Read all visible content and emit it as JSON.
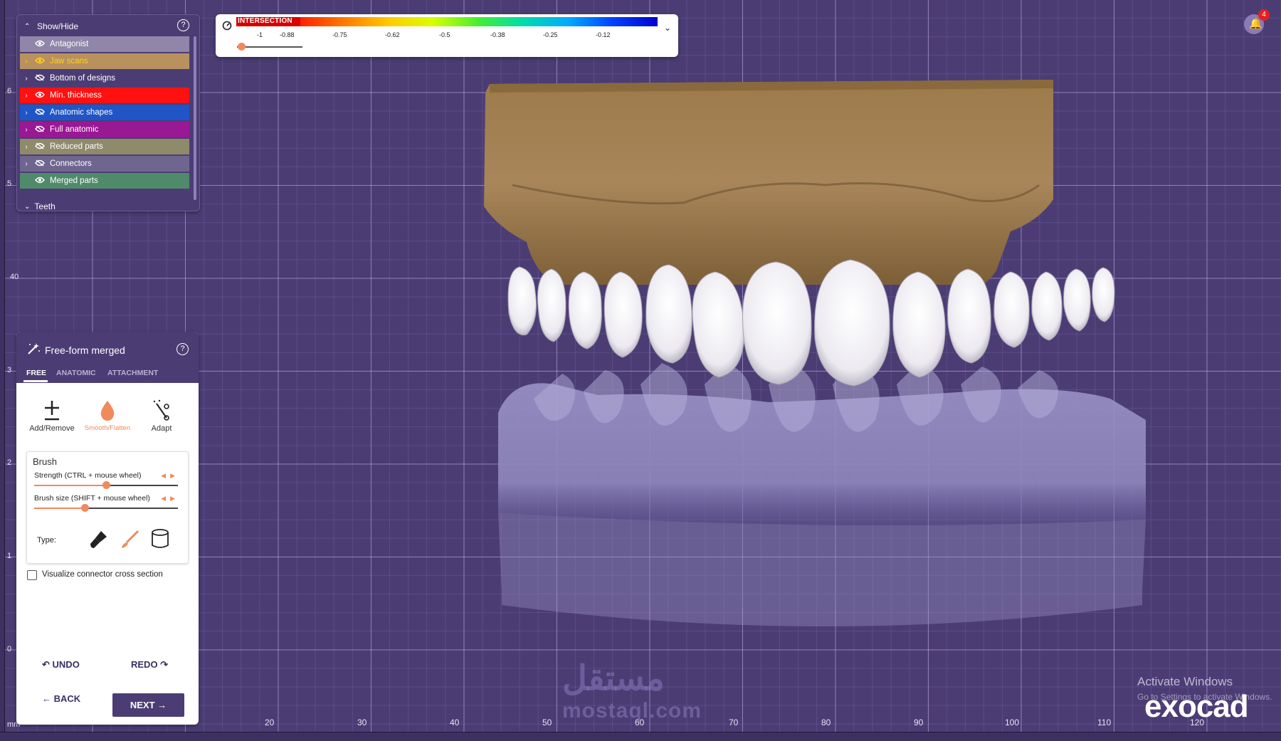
{
  "show_hide": {
    "title": "Show/Hide",
    "help_icon": "?",
    "layers": [
      {
        "label": "Antagonist",
        "expandable": false,
        "visible": true,
        "color": "#8f86a9",
        "text_color": "#ffffff"
      },
      {
        "label": "Jaw scans",
        "expandable": true,
        "visible": true,
        "color": "#b8915e",
        "text_color": "#ffd21a"
      },
      {
        "label": "Bottom of designs",
        "expandable": true,
        "visible": false,
        "color": "#4b3d74",
        "text_color": "#ffffff"
      },
      {
        "label": "Min. thickness",
        "expandable": true,
        "visible": true,
        "color": "#ff1111",
        "text_color": "#ffffff"
      },
      {
        "label": "Anatomic shapes",
        "expandable": true,
        "visible": false,
        "color": "#1f55c6",
        "text_color": "#ffffff"
      },
      {
        "label": "Full anatomic",
        "expandable": true,
        "visible": false,
        "color": "#991894",
        "text_color": "#ffffff"
      },
      {
        "label": "Reduced parts",
        "expandable": true,
        "visible": false,
        "color": "#8f8a6a",
        "text_color": "#ffffff"
      },
      {
        "label": "Connectors",
        "expandable": true,
        "visible": false,
        "color": "#6f6690",
        "text_color": "#ffffff"
      },
      {
        "label": "Merged parts",
        "expandable": false,
        "visible": true,
        "color": "#4f8a6a",
        "text_color": "#ffffff"
      }
    ],
    "teeth_label": "Teeth"
  },
  "colorbar": {
    "label": "INTERSECTION",
    "ticks": [
      "-1",
      "-0.88",
      "-0.75",
      "-0.62",
      "-0.5",
      "-0.38",
      "-0.25",
      "-0.12"
    ],
    "dropdown_icon": "chevron-down-icon"
  },
  "notifications": {
    "count": "4",
    "icon": "bell-icon"
  },
  "tool_panel": {
    "title": "Free-form merged",
    "tabs": [
      "FREE",
      "ANATOMIC",
      "ATTACHMENT"
    ],
    "active_tab": "FREE",
    "tools": [
      {
        "label": "Add/Remove",
        "icon": "plus-minus-icon"
      },
      {
        "label": "Smooth/Flatten",
        "icon": "drop-icon",
        "active": true
      },
      {
        "label": "Adapt",
        "icon": "magic-wand-icon"
      }
    ],
    "brush": {
      "title": "Brush",
      "strength_label": "Strength (CTRL + mouse wheel)",
      "strength_value": 0.5,
      "size_label": "Brush size (SHIFT + mouse wheel)",
      "size_value": 0.35,
      "type_label": "Type:"
    },
    "visualize_label": "Visualize connector cross section",
    "visualize_checked": false,
    "undo_label": "UNDO",
    "redo_label": "REDO",
    "back_label": "BACK",
    "next_label": "NEXT"
  },
  "rulers": {
    "bottom": [
      "mm",
      "20",
      "30",
      "40",
      "50",
      "60",
      "70",
      "80",
      "90",
      "100",
      "110",
      "120"
    ],
    "left": [
      "6",
      "5",
      "40",
      "3",
      "2",
      "1",
      "0"
    ]
  },
  "watermark": {
    "arabic": "مستقل",
    "latin": "mostaql.com"
  },
  "activate": {
    "title": "Activate Windows",
    "subtitle": "Go to Settings to activate Windows."
  },
  "brand": {
    "logo": "exocad"
  },
  "colors": {
    "accent": "#f08a5d",
    "panel": "#4b3d74",
    "grid_bg": "#4b3d74"
  }
}
